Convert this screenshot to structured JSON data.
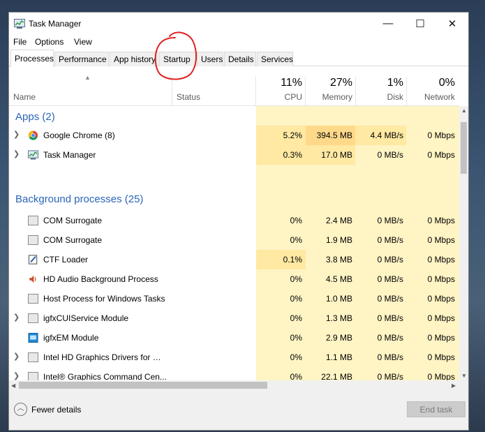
{
  "window": {
    "title": "Task Manager",
    "minimize": "—",
    "maximize": "☐",
    "close": "✕"
  },
  "menu": [
    "File",
    "Options",
    "View"
  ],
  "tabs": [
    "Processes",
    "Performance",
    "App history",
    "Startup",
    "Users",
    "Details",
    "Services"
  ],
  "active_tab": "Processes",
  "columns": {
    "name": "Name",
    "status": "Status",
    "cpu": {
      "pct": "11%",
      "label": "CPU"
    },
    "memory": {
      "pct": "27%",
      "label": "Memory"
    },
    "disk": {
      "pct": "1%",
      "label": "Disk"
    },
    "network": {
      "pct": "0%",
      "label": "Network"
    }
  },
  "groups": {
    "apps": "Apps (2)",
    "background": "Background processes (25)"
  },
  "apps": [
    {
      "name": "Google Chrome (8)",
      "icon": "chrome-icon",
      "cpu": "5.2%",
      "mem": "394.5 MB",
      "disk": "4.4 MB/s",
      "net": "0 Mbps"
    },
    {
      "name": "Task Manager",
      "icon": "task-manager-icon",
      "cpu": "0.3%",
      "mem": "17.0 MB",
      "disk": "0 MB/s",
      "net": "0 Mbps"
    }
  ],
  "background": [
    {
      "name": "COM Surrogate",
      "cpu": "0%",
      "mem": "2.4 MB",
      "disk": "0 MB/s",
      "net": "0 Mbps"
    },
    {
      "name": "COM Surrogate",
      "cpu": "0%",
      "mem": "1.9 MB",
      "disk": "0 MB/s",
      "net": "0 Mbps"
    },
    {
      "name": "CTF Loader",
      "cpu": "0.1%",
      "mem": "3.8 MB",
      "disk": "0 MB/s",
      "net": "0 Mbps"
    },
    {
      "name": "HD Audio Background Process",
      "cpu": "0%",
      "mem": "4.5 MB",
      "disk": "0 MB/s",
      "net": "0 Mbps"
    },
    {
      "name": "Host Process for Windows Tasks",
      "cpu": "0%",
      "mem": "1.0 MB",
      "disk": "0 MB/s",
      "net": "0 Mbps"
    },
    {
      "name": "igfxCUIService Module",
      "cpu": "0%",
      "mem": "1.3 MB",
      "disk": "0 MB/s",
      "net": "0 Mbps"
    },
    {
      "name": "igfxEM Module",
      "cpu": "0%",
      "mem": "2.9 MB",
      "disk": "0 MB/s",
      "net": "0 Mbps"
    },
    {
      "name": "Intel HD Graphics Drivers for Wi...",
      "cpu": "0%",
      "mem": "1.1 MB",
      "disk": "0 MB/s",
      "net": "0 Mbps"
    },
    {
      "name": "Intel® Graphics Command Cen...",
      "cpu": "0%",
      "mem": "22.1 MB",
      "disk": "0 MB/s",
      "net": "0 Mbps"
    }
  ],
  "footer": {
    "fewer_details": "Fewer details",
    "end_task": "End task"
  },
  "colors": {
    "group_label": "#2a65b7",
    "heat_light": "#fff4c4",
    "heat_medium": "#ffe9a3",
    "heat_strong": "#ffd98a",
    "annotation": "#e02020"
  }
}
